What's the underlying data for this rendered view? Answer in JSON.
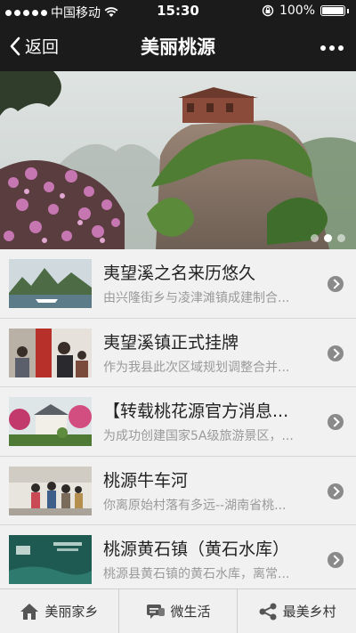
{
  "status_bar": {
    "carrier": "中国移动",
    "time": "15:30",
    "battery": "100%"
  },
  "nav": {
    "back_label": "返回",
    "title": "美丽桃源"
  },
  "carousel": {
    "slide_count": 3,
    "active_index": 1
  },
  "articles": [
    {
      "title": "夷望溪之名来历悠久",
      "desc": "由兴隆街乡与凌津滩镇成建制合..."
    },
    {
      "title": "夷望溪镇正式挂牌",
      "desc": "作为我县此次区域规划调整合并..."
    },
    {
      "title": "【转载桃花源官方消息...",
      "desc": "为成功创建国家5A级旅游景区，..."
    },
    {
      "title": "桃源牛车河",
      "desc": "你离原始村落有多远--湖南省桃..."
    },
    {
      "title": "桃源黄石镇（黄石水库）",
      "desc": "桃源县黄石镇的黄石水库，离常..."
    }
  ],
  "tabs": [
    {
      "label": "美丽家乡",
      "icon": "home-icon"
    },
    {
      "label": "微生活",
      "icon": "chat-icon"
    },
    {
      "label": "最美乡村",
      "icon": "share-icon"
    }
  ],
  "colors": {
    "bar": "#1b1b1b",
    "list_bg": "#f1f1f1",
    "desc_text": "#9a9a9a",
    "arrow": "#8a8a8a"
  }
}
